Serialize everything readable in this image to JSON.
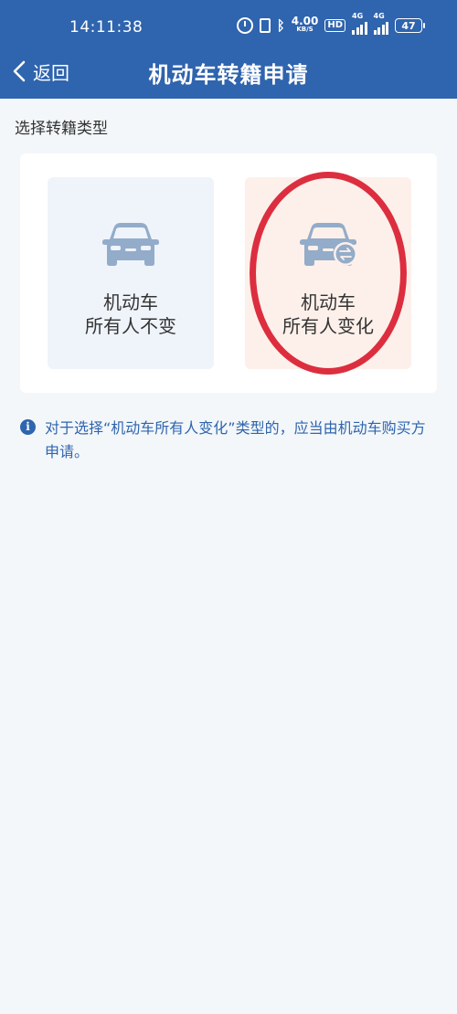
{
  "status_bar": {
    "time": "14:11:38",
    "speed_value": "4.00",
    "speed_unit": "KB/S",
    "hd": "HD",
    "network_1": "4G",
    "network_2": "4G",
    "battery": "47"
  },
  "nav": {
    "back_label": "返回",
    "title": "机动车转籍申请"
  },
  "section": {
    "label": "选择转籍类型"
  },
  "options": [
    {
      "line1": "机动车",
      "line2": "所有人不变",
      "icon": "car-icon"
    },
    {
      "line1": "机动车",
      "line2": "所有人变化",
      "icon": "car-transfer-icon"
    }
  ],
  "notice": {
    "text": "对于选择“机动车所有人变化”类型的，应当由机动车购买方申请。"
  },
  "colors": {
    "primary": "#2f64ae",
    "highlight": "#dc2e3f",
    "icon": "#93acc9"
  }
}
